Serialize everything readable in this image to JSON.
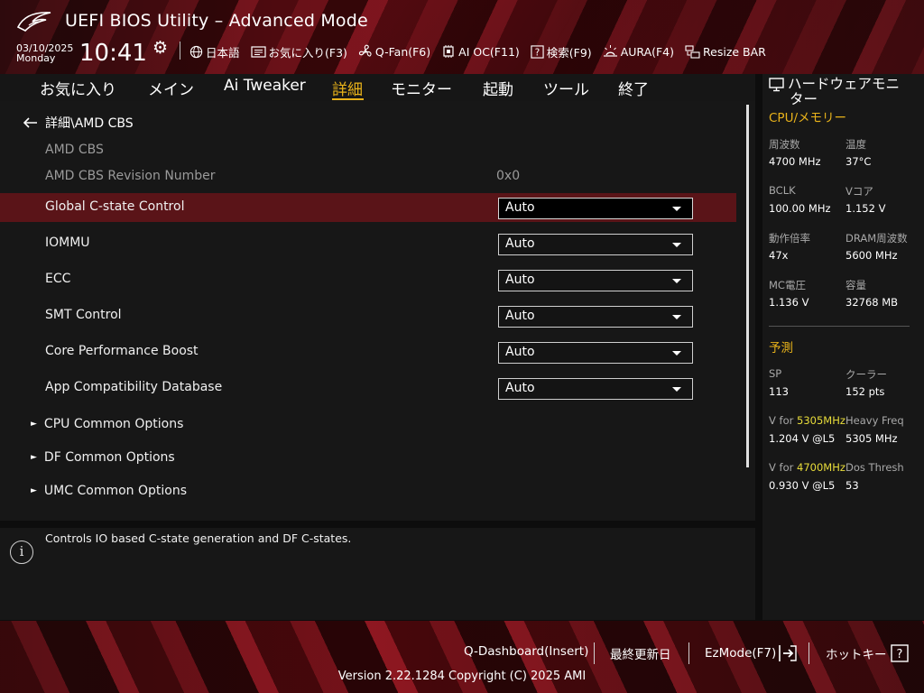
{
  "header": {
    "title": "UEFI BIOS Utility – Advanced Mode",
    "date": "03/10/2025",
    "weekday": "Monday",
    "time": "10:41",
    "toolbar": [
      {
        "label": "日本語",
        "icon": "globe-icon"
      },
      {
        "label": "お気に入り(F3)",
        "icon": "favorites-icon"
      },
      {
        "label": "Q-Fan(F6)",
        "icon": "fan-icon"
      },
      {
        "label": "AI OC(F11)",
        "icon": "ai-oc-icon"
      },
      {
        "label": "検索(F9)",
        "icon": "search-help-icon"
      },
      {
        "label": "AURA(F4)",
        "icon": "aura-icon"
      },
      {
        "label": "Resize BAR",
        "icon": "resize-bar-icon"
      }
    ]
  },
  "nav": {
    "tabs": [
      "お気に入り",
      "メイン",
      "Ai Tweaker",
      "詳細",
      "モニター",
      "起動",
      "ツール",
      "終了"
    ],
    "active": "詳細"
  },
  "content": {
    "breadcrumb": "詳細\\AMD CBS",
    "section_title": "AMD CBS",
    "revision_label": "AMD CBS Revision Number",
    "revision_value": "0x0",
    "settings": [
      {
        "label": "Global C-state Control",
        "value": "Auto"
      },
      {
        "label": "IOMMU",
        "value": "Auto"
      },
      {
        "label": "ECC",
        "value": "Auto"
      },
      {
        "label": "SMT Control",
        "value": "Auto"
      },
      {
        "label": "Core Performance Boost",
        "value": "Auto"
      },
      {
        "label": "App Compatibility Database",
        "value": "Auto"
      }
    ],
    "submenus": [
      "CPU Common Options",
      "DF Common Options",
      "UMC Common Options"
    ]
  },
  "help": {
    "text": "Controls IO based C-state generation and DF C-states."
  },
  "hw_monitor": {
    "title_line1": "ハードウェアモニ",
    "title_line2": "ター",
    "cpu_mem_title": "CPU/メモリー",
    "freq_label": "周波数",
    "freq_value": "4700 MHz",
    "temp_label": "温度",
    "temp_value": "37°C",
    "bclk_label": "BCLK",
    "bclk_value": "100.00 MHz",
    "vcore_label": "Vコア",
    "vcore_value": "1.152 V",
    "ratio_label": "動作倍率",
    "ratio_value": "47x",
    "dram_label": "DRAM周波数",
    "dram_value": "5600 MHz",
    "mc_label": "MC電圧",
    "mc_value": "1.136 V",
    "cap_label": "容量",
    "cap_value": "32768 MB",
    "predict_title": "予測",
    "sp_label": "SP",
    "sp_value": "113",
    "cooler_label": "クーラー",
    "cooler_value": "152 pts",
    "vfor1_prefix": "V for ",
    "vfor1_freq": "5305MHz",
    "vfor1_value": "1.204 V @L5",
    "heavy_label": "Heavy Freq",
    "heavy_value": "5305 MHz",
    "vfor2_prefix": "V for ",
    "vfor2_freq": "4700MHz",
    "vfor2_value": "0.930 V @L5",
    "dos_label": "Dos Thresh",
    "dos_value": "53"
  },
  "footer": {
    "qdash": "Q-Dashboard(Insert)",
    "last_modified": "最終更新日",
    "ezmode": "EzMode(F7)",
    "hotkeys": "ホットキー",
    "version": "Version 2.22.1284 Copyright (C) 2025 AMI"
  },
  "colors": {
    "accent": "#e8b21a",
    "highlight_row": "#5a1418",
    "panel": "#171717",
    "yellow_freq": "#e8dc3a"
  }
}
